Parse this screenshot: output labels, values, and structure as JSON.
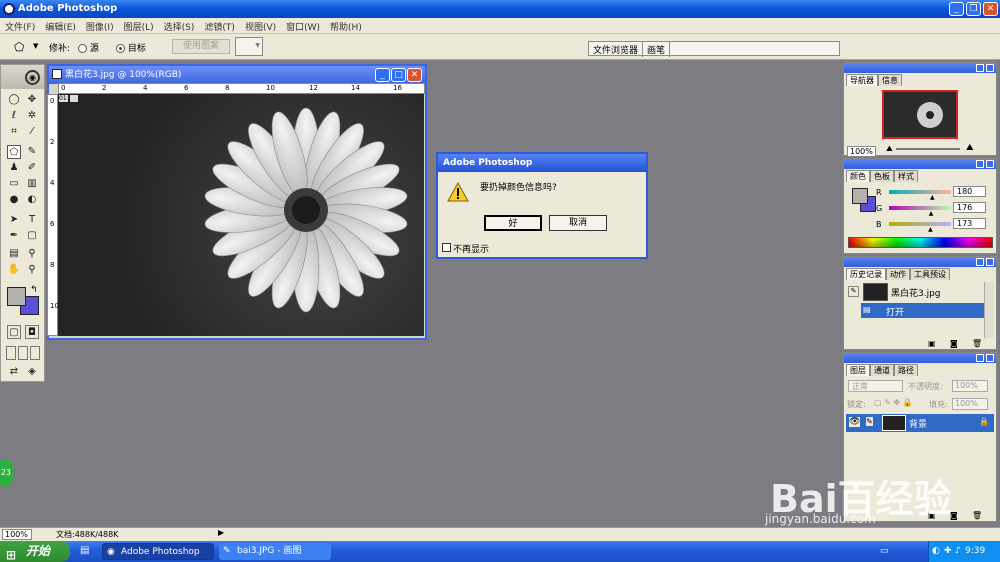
{
  "app": {
    "title": "Adobe Photoshop"
  },
  "menu": [
    "文件(F)",
    "编辑(E)",
    "图像(I)",
    "图层(L)",
    "选择(S)",
    "滤镜(T)",
    "视图(V)",
    "窗口(W)",
    "帮助(H)"
  ],
  "options": {
    "patch_label": "修补:",
    "source_label": "源",
    "dest_label": "目标",
    "use_pattern_label": "使用图案",
    "tabs": [
      "文件浏览器",
      "画笔"
    ]
  },
  "document": {
    "title": "黑白花3.jpg @ 100%(RGB)",
    "ruler_h": [
      "0",
      "2",
      "4",
      "6",
      "8",
      "10",
      "12",
      "14",
      "16"
    ],
    "ruler_v": [
      "0",
      "2",
      "4",
      "6",
      "8",
      "10"
    ],
    "corner_badge": "01"
  },
  "dialog": {
    "title": "Adobe Photoshop",
    "message": "要扔掉颜色信息吗?",
    "ok_label": "好",
    "cancel_label": "取消",
    "checkbox_label": "不再显示"
  },
  "navigator": {
    "tabs": [
      "导航器",
      "信息"
    ],
    "zoom": "100%"
  },
  "color": {
    "tabs": [
      "颜色",
      "色板",
      "样式"
    ],
    "r_label": "R",
    "g_label": "G",
    "b_label": "B",
    "r": "180",
    "g": "176",
    "b": "173",
    "r_fraction": 0.71,
    "g_fraction": 0.69,
    "b_fraction": 0.68,
    "fg_color": "#b4b0ad",
    "bg_color": "#5a4fd6"
  },
  "history": {
    "tabs": [
      "历史记录",
      "动作",
      "工具预设"
    ],
    "snapshot": "黑白花3.jpg",
    "step": "打开"
  },
  "layers": {
    "tabs": [
      "图层",
      "通道",
      "路径"
    ],
    "blend_mode": "正常",
    "opacity_label": "不透明度:",
    "opacity": "100%",
    "lock_label": "锁定:",
    "fill_label": "填充:",
    "fill": "100%",
    "layer_name": "背景"
  },
  "status": {
    "zoom": "100%",
    "doc_info": "文档:488K/488K"
  },
  "taskbar": {
    "start_label": "开始",
    "tasks": [
      "Adobe Photoshop",
      "bai3.JPG - 画图"
    ],
    "clock": "9:39"
  },
  "watermark": {
    "logo": "Bai百经验",
    "url": "jingyan.baidu.com"
  },
  "badge": {
    "text": "23"
  }
}
